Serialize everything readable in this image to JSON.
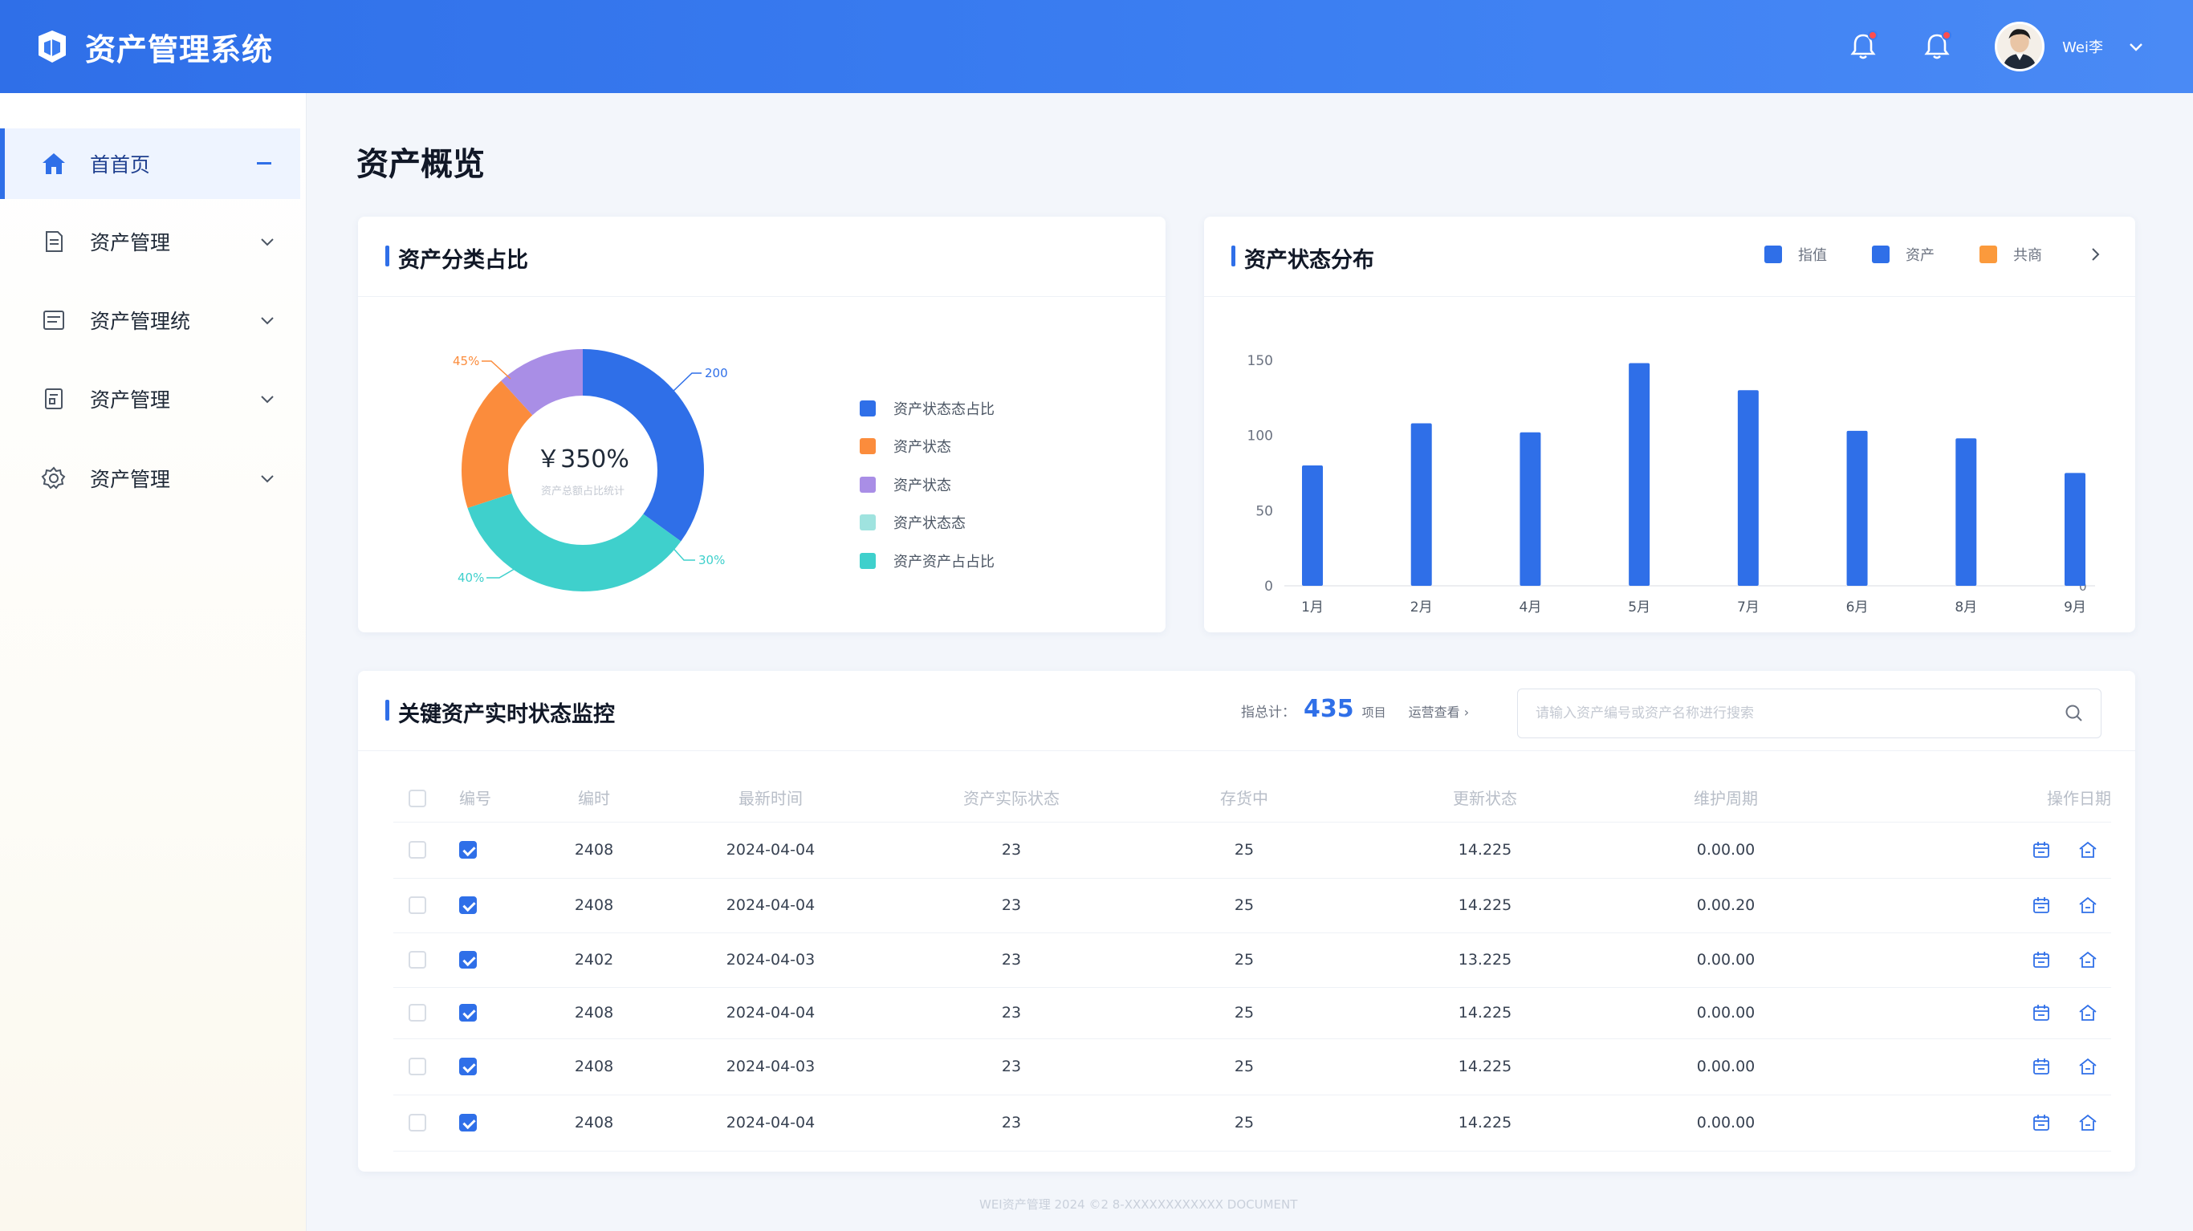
{
  "header": {
    "title": "资产管理系统",
    "user_name": "Wei李",
    "notification_count_1": "",
    "notification_count_2": ""
  },
  "sidebar": {
    "items": [
      {
        "label": "首首页",
        "active": true
      },
      {
        "label": "资产管理"
      },
      {
        "label": "资产管理统"
      },
      {
        "label": "资产管理"
      },
      {
        "label": "资产管理"
      }
    ]
  },
  "main": {
    "page_title": "资产概览"
  },
  "pie_card": {
    "title": "资产分类占比",
    "center_value": "￥350%",
    "center_sub": "资产总额占比统计",
    "labels": {
      "top_right": "200",
      "top_left": "45%",
      "bottom_right": "30%",
      "bottom_left": "40%"
    },
    "legend": [
      {
        "label": "资产状态态占比",
        "color": "#2f6fe8"
      },
      {
        "label": "资产状态",
        "color": "#fb8c3c"
      },
      {
        "label": "资产状态",
        "color": "#a98ee6"
      },
      {
        "label": "资产状态态",
        "color": "#9fe3df"
      },
      {
        "label": "资产资产占占比",
        "color": "#3fd0cc"
      }
    ]
  },
  "chart_data": {
    "type": "bar",
    "title": "资产状态分布",
    "categories": [
      "1月",
      "2月",
      "4月",
      "5月",
      "7月",
      "6月",
      "8月",
      "9月"
    ],
    "values": [
      80,
      108,
      102,
      148,
      130,
      103,
      98,
      75
    ],
    "ylim": [
      0,
      160
    ],
    "yticks": [
      0,
      50,
      100,
      150
    ],
    "right_axis_label": "0",
    "grid": false,
    "legend_position": "top-right",
    "legend": [
      {
        "label": "指值",
        "color": "#2f6fe8"
      },
      {
        "label": "资产",
        "color": "#2f6fe8"
      },
      {
        "label": "共商",
        "color": "#fb9a3c"
      }
    ]
  },
  "table_card": {
    "title": "关键资产实时状态监控",
    "stats_label": "指总计：",
    "stats_value": "435",
    "stats_unit": "项目",
    "stats_link": "运营查看 ›",
    "search_placeholder": "请输入资产编号或资产名称进行搜索",
    "columns": [
      "编号",
      "编时",
      "最新时间",
      "资产实际状态",
      "存货中",
      "更新状态",
      "维护周期",
      "操作日期"
    ],
    "rows": [
      {
        "id": "2408",
        "date": "2024-04-04",
        "status": "23",
        "stock": "25",
        "update": "14.225",
        "cycle": "0.00.00"
      },
      {
        "id": "2408",
        "date": "2024-04-04",
        "status": "23",
        "stock": "25",
        "update": "14.225",
        "cycle": "0.00.20"
      },
      {
        "id": "2402",
        "date": "2024-04-03",
        "status": "23",
        "stock": "25",
        "update": "13.225",
        "cycle": "0.00.00"
      },
      {
        "id": "2408",
        "date": "2024-04-04",
        "status": "23",
        "stock": "25",
        "update": "14.225",
        "cycle": "0.00.00"
      },
      {
        "id": "2408",
        "date": "2024-04-03",
        "status": "23",
        "stock": "25",
        "update": "14.225",
        "cycle": "0.00.00"
      },
      {
        "id": "2408",
        "date": "2024-04-04",
        "status": "23",
        "stock": "25",
        "update": "14.225",
        "cycle": "0.00.00"
      }
    ]
  },
  "footer": {
    "text": "WEI资产管理 2024 ©2 8-XXXXXXXXXXXX DOCUMENT"
  },
  "colors": {
    "primary": "#2f6fe8",
    "orange": "#fb8c3c",
    "purple": "#a98ee6",
    "teal": "#3fd0cc"
  }
}
